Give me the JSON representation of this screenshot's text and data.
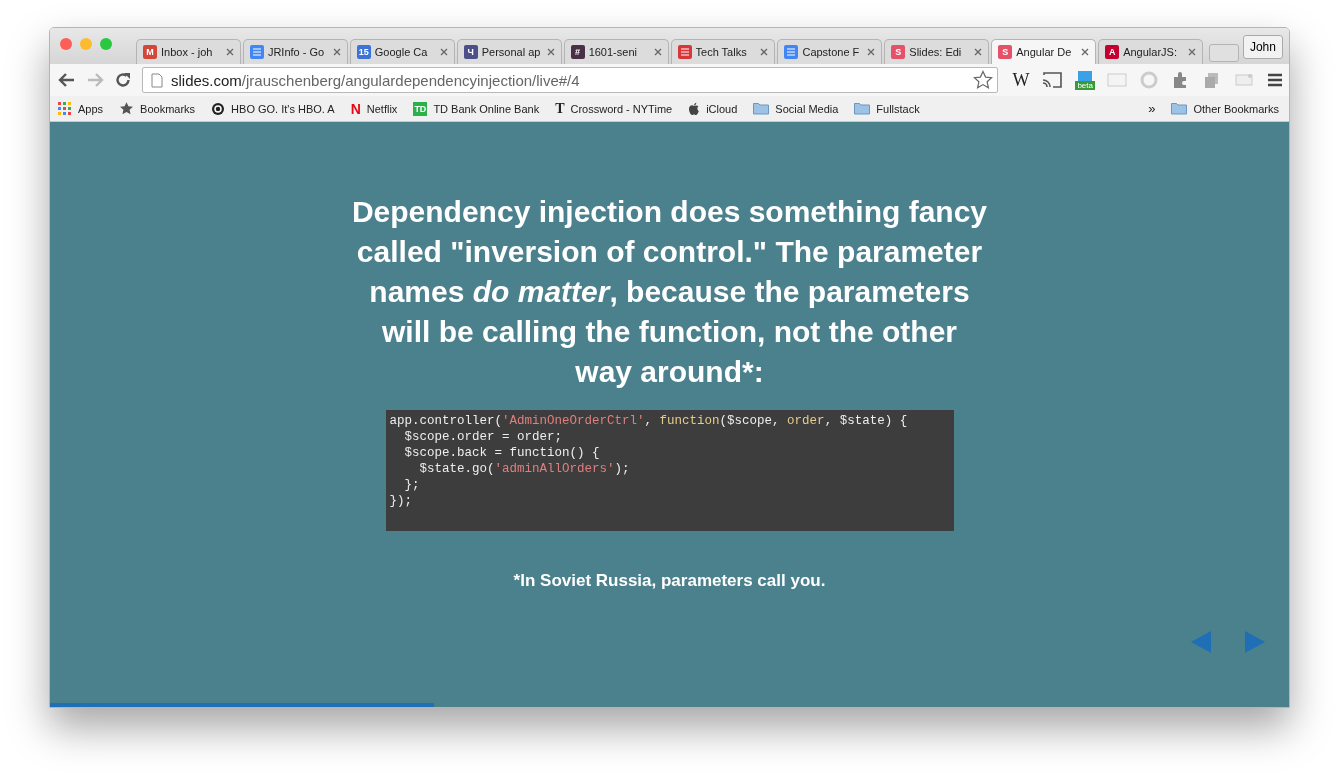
{
  "tabs": [
    {
      "title": "Inbox - joh",
      "color": "#d44638",
      "glyph": "M",
      "selected": false
    },
    {
      "title": "JRInfo - Go",
      "color": "#4285f4",
      "selected": false
    },
    {
      "title": "Google Ca",
      "color": "#3b73d8",
      "glyph": "15",
      "selected": false
    },
    {
      "title": "Personal ap",
      "color": "#4b4f8a",
      "glyph": "Ч",
      "selected": false
    },
    {
      "title": "1601-seni",
      "color": "#4a3046",
      "glyph": "#",
      "selected": false
    },
    {
      "title": "Tech Talks",
      "color": "#d9363a",
      "selected": false
    },
    {
      "title": "Capstone F",
      "color": "#4285f4",
      "selected": false
    },
    {
      "title": "Slides: Edi",
      "color": "#e4526a",
      "glyph": "S",
      "selected": false
    },
    {
      "title": "Angular De",
      "color": "#e4526a",
      "glyph": "S",
      "selected": true
    },
    {
      "title": "AngularJS:",
      "color": "#c3002f",
      "glyph": "A",
      "selected": false
    }
  ],
  "profile": "John",
  "address": {
    "host": "slides.com",
    "path": "/jrauschenberg/angulardependencyinjection/live#/4"
  },
  "extensions": {
    "wiki": "W",
    "badge": "beta"
  },
  "bookmarks": [
    {
      "label": "Apps",
      "kind": "apps"
    },
    {
      "label": "Bookmarks",
      "kind": "star"
    },
    {
      "label": "HBO GO. It's HBO. A",
      "kind": "circle"
    },
    {
      "label": "Netflix",
      "kind": "netflix",
      "glyph": "N"
    },
    {
      "label": "TD Bank Online Bank",
      "kind": "td",
      "glyph": "TD"
    },
    {
      "label": "Crossword - NYTime",
      "kind": "nyt",
      "glyph": "T"
    },
    {
      "label": "iCloud",
      "kind": "apple"
    },
    {
      "label": "Social Media",
      "kind": "folder"
    },
    {
      "label": "Fullstack",
      "kind": "folder"
    }
  ],
  "more_bookmarks": "»",
  "other_bookmarks": "Other Bookmarks",
  "slide": {
    "heading": "Dependency injection does something fancy called \"inversion of control.\" The parameter names *do matter*, because the parameters will be calling the function, not the other way around*:",
    "code": [
      [
        {
          "text": "app.controller(",
          "kind": "plain"
        },
        {
          "text": "'AdminOneOrderCtrl'",
          "kind": "string"
        },
        {
          "text": ", ",
          "kind": "plain"
        },
        {
          "text": "function",
          "kind": "keyword"
        },
        {
          "text": "($scope, ",
          "kind": "plain"
        },
        {
          "text": "order",
          "kind": "keyword"
        },
        {
          "text": ", $state) {",
          "kind": "plain"
        }
      ],
      [
        {
          "text": "  $scope.order = order;",
          "kind": "plain"
        }
      ],
      [
        {
          "text": "  $scope.back = function() {",
          "kind": "plain"
        }
      ],
      [
        {
          "text": "    $state.go(",
          "kind": "plain"
        },
        {
          "text": "'adminAllOrders'",
          "kind": "string"
        },
        {
          "text": ");",
          "kind": "plain"
        }
      ],
      [
        {
          "text": "  };",
          "kind": "plain"
        }
      ],
      [
        {
          "text": "});",
          "kind": "plain"
        }
      ]
    ],
    "footnote": "*In Soviet Russia, parameters call you.",
    "progress": {
      "level": 0.31
    }
  }
}
